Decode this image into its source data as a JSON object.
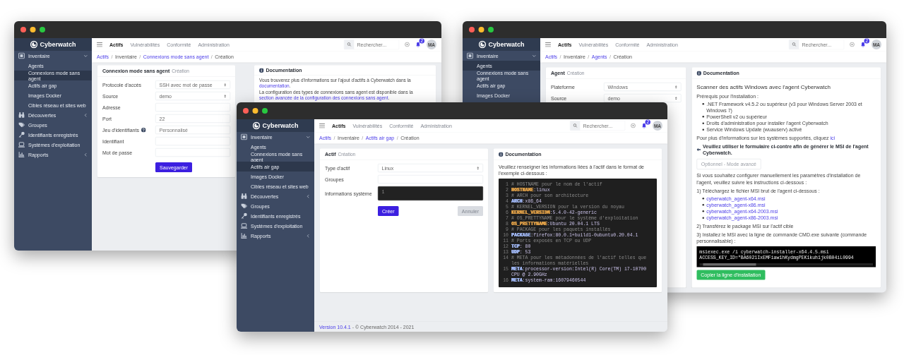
{
  "windows": [
    {
      "sidebar": {
        "logo": "Cyberwatch",
        "items": [
          {
            "kind": "group",
            "label": "Inventaire",
            "expanded": true,
            "children": [
              {
                "label": "Agents",
                "selected": false
              },
              {
                "label": "Connexions mode sans agent",
                "selected": true
              },
              {
                "label": "Actifs air gap",
                "selected": false
              },
              {
                "label": "Images Docker",
                "selected": false
              },
              {
                "label": "Cibles réseau et sites web",
                "selected": false
              }
            ]
          },
          {
            "kind": "group",
            "label": "Découvertes",
            "expanded": false
          },
          {
            "kind": "link",
            "label": "Groupes"
          },
          {
            "kind": "link",
            "label": "Identifiants enregistrés"
          },
          {
            "kind": "link",
            "label": "Systèmes d'exploitation"
          },
          {
            "kind": "group",
            "label": "Rapports",
            "expanded": false
          }
        ]
      },
      "topbar": {
        "tabs": [
          {
            "label": "Actifs",
            "selected": true
          },
          {
            "label": "Vulnérabilités",
            "selected": false
          },
          {
            "label": "Conformité",
            "selected": false
          },
          {
            "label": "Administration",
            "selected": false
          }
        ],
        "search_placeholder": "Rechercher...",
        "badge": "2",
        "avatar": "MA"
      },
      "breadcrumb": {
        "separator": "/",
        "items": [
          {
            "label": "Actifs",
            "link": true
          },
          {
            "label": "Inventaire",
            "link": false
          },
          {
            "label": "Connexions mode sans agent",
            "link": true
          },
          {
            "label": "Création",
            "link": false
          }
        ]
      },
      "form": {
        "title": "Connexion mode sans agent",
        "subtitle": "Création",
        "fields": [
          {
            "label": "Protocole d'accès",
            "kind": "select",
            "value": "SSH avec mot de passe"
          },
          {
            "label": "Source",
            "kind": "select",
            "value": "demo"
          },
          {
            "label": "Adresse",
            "kind": "input"
          },
          {
            "label": "Port",
            "kind": "input",
            "value": "22"
          },
          {
            "label": "Jeu d'identifiants",
            "kind": "input",
            "help": true,
            "placeholder": "Personnalisé"
          },
          {
            "label": "Identifiant",
            "kind": "input"
          },
          {
            "label": "Mot de passe",
            "kind": "input"
          }
        ],
        "buttons": [
          {
            "label": "Sauvegarder",
            "kind": "primary"
          }
        ]
      },
      "documentation": {
        "title": "Documentation",
        "blocks": [
          {
            "kind": "paragraph",
            "text": "Vous trouverez plus d'informations sur l'ajout d'actifs à Cyberwatch dans la ",
            "link": "documentation",
            "after": "."
          },
          {
            "kind": "paragraph",
            "text": "La configuration des types de connexions sans agent est disponible dans la ",
            "link": "section avancée de la configuration des connexions sans agent",
            "after": "."
          }
        ]
      }
    },
    {
      "sidebar": {
        "logo": "Cyberwatch",
        "items": [
          {
            "kind": "group",
            "label": "Inventaire",
            "expanded": true,
            "children": [
              {
                "label": "Agents",
                "selected": true
              },
              {
                "label": "Connexions mode sans agent",
                "selected": false
              },
              {
                "label": "Actifs air gap",
                "selected": false
              },
              {
                "label": "Images Docker",
                "selected": false
              }
            ]
          }
        ]
      },
      "topbar": {
        "tabs": [
          {
            "label": "Actifs",
            "selected": true
          },
          {
            "label": "Vulnérabilités",
            "selected": false
          },
          {
            "label": "Conformité",
            "selected": false
          },
          {
            "label": "Administration",
            "selected": false
          }
        ],
        "search_placeholder": "Rechercher...",
        "badge": "2",
        "avatar": "MA"
      },
      "breadcrumb": {
        "separator": "/",
        "items": [
          {
            "label": "Actifs",
            "link": true
          },
          {
            "label": "Inventaire",
            "link": false
          },
          {
            "label": "Agents",
            "link": true
          },
          {
            "label": "Création",
            "link": false
          }
        ]
      },
      "form": {
        "title": "Agent",
        "subtitle": "Création",
        "fields": [
          {
            "label": "Plateforme",
            "kind": "select",
            "value": "Windows"
          },
          {
            "label": "Source",
            "kind": "select",
            "value": "demo"
          }
        ]
      },
      "documentation": {
        "title": "Documentation",
        "blocks": [
          {
            "kind": "heading",
            "text": "Scanner des actifs Windows avec l'agent Cyberwatch"
          },
          {
            "kind": "paragraph",
            "text": "Prérequis pour l'installation :"
          },
          {
            "kind": "list",
            "items": [
              ".NET Framework v4.5.2 ou supérieur (v3 pour Windows Server 2003 et Windows 7)",
              "PowerShell v2 ou supérieur",
              "Droits d'administration pour installer l'agent Cyberwatch",
              "Service Windows Update (wuauserv) activé"
            ]
          },
          {
            "kind": "paragraph",
            "text": "Pour plus d'informations sur les systèmes supportés, cliquez ",
            "link": "ici"
          },
          {
            "kind": "note",
            "text": "Veuillez utiliser le formulaire ci-contre afin de générer le MSI de l'agent Cyberwatch."
          },
          {
            "kind": "toggle",
            "label": "Optionnel - Mode avancé"
          },
          {
            "kind": "paragraph",
            "text": "Si vous souhaitez configurer manuellement les paramètres d'installation de l'agent, veuillez suivre les instructions ci-dessous :"
          },
          {
            "kind": "paragraph",
            "text": "1) Téléchargez le fichier MSI brut de l'agent ci-dessous :"
          },
          {
            "kind": "links",
            "items": [
              "cyberwatch_agent-x64.msi",
              "cyberwatch_agent-x86.msi",
              "cyberwatch_agent-x64-2003.msi",
              "cyberwatch_agent-x86-2003.msi"
            ]
          },
          {
            "kind": "paragraph",
            "text": "2) Transférez le package MSI sur l'actif cible"
          },
          {
            "kind": "paragraph",
            "text": "3) Installez le MSI avec la ligne de commande CMD.exe suivante (commande personnalisable) :"
          },
          {
            "kind": "command",
            "text": "msiexec.exe /i cyberwatch-installer-x64.4.5.msi ACCESS_KEY_ID=\"BA6021IxEMFiaw1hKydmgPEK1kuh1jk0B04iL0994"
          },
          {
            "kind": "button",
            "label": "Copier la ligne d'installation"
          }
        ]
      }
    },
    {
      "sidebar": {
        "logo": "Cyberwatch",
        "items": [
          {
            "kind": "group",
            "label": "Inventaire",
            "expanded": true,
            "children": [
              {
                "label": "Agents",
                "selected": false
              },
              {
                "label": "Connexions mode sans agent",
                "selected": false
              },
              {
                "label": "Actifs air gap",
                "selected": true
              },
              {
                "label": "Images Docker",
                "selected": false
              },
              {
                "label": "Cibles réseau et sites web",
                "selected": false
              }
            ]
          },
          {
            "kind": "group",
            "label": "Découvertes",
            "expanded": false
          },
          {
            "kind": "link",
            "label": "Groupes"
          },
          {
            "kind": "link",
            "label": "Identifiants enregistrés"
          },
          {
            "kind": "link",
            "label": "Systèmes d'exploitation"
          },
          {
            "kind": "group",
            "label": "Rapports",
            "expanded": false
          }
        ]
      },
      "topbar": {
        "tabs": [
          {
            "label": "Actifs",
            "selected": true
          },
          {
            "label": "Vulnérabilités",
            "selected": false
          },
          {
            "label": "Conformité",
            "selected": false
          },
          {
            "label": "Administration",
            "selected": false
          }
        ],
        "search_placeholder": "Rechercher...",
        "badge": "2",
        "avatar": "MA"
      },
      "breadcrumb": {
        "separator": "/",
        "items": [
          {
            "label": "Actifs",
            "link": true
          },
          {
            "label": "Inventaire",
            "link": false
          },
          {
            "label": "Actifs air gap",
            "link": true
          },
          {
            "label": "Création",
            "link": false
          }
        ]
      },
      "form": {
        "title": "Actif",
        "subtitle": "Création",
        "fields": [
          {
            "label": "Type d'actif",
            "kind": "select",
            "value": "Linux"
          },
          {
            "label": "Groupes",
            "kind": "input"
          },
          {
            "label": "Informations système",
            "kind": "code",
            "line": "1"
          }
        ],
        "buttons": [
          {
            "label": "Créer",
            "kind": "primary"
          },
          {
            "label": "Annuler",
            "kind": "secondary"
          }
        ]
      },
      "documentation": {
        "title": "Documentation",
        "blocks": [
          {
            "kind": "paragraph",
            "text": "Veuillez renseigner les informations liées à l'actif dans le format de l'exemple ci-dessous :"
          },
          {
            "kind": "code",
            "lines": [
              {
                "no": "1",
                "kind": "comment",
                "text": "# HOSTNAME pour le nom de l'actif"
              },
              {
                "no": "2",
                "kind": "entry",
                "key": "HOSTNAME",
                "value": ":linux",
                "color": "#e0a048"
              },
              {
                "no": "3",
                "kind": "comment",
                "text": "# ARCH pour son architecture"
              },
              {
                "no": "4",
                "kind": "entry",
                "key": "ARCH",
                "value": ":x86_64",
                "color": "#9fb6f2"
              },
              {
                "no": "5",
                "kind": "comment",
                "text": "# KERNEL_VERSION pour la version du noyau"
              },
              {
                "no": "6",
                "kind": "entry",
                "key": "KERNEL_VERSION",
                "value": ":5.4.0-42-generic",
                "color": "#e0a048"
              },
              {
                "no": "7",
                "kind": "comment",
                "text": "# OS_PRETTYNAME pour le système d'exploitation"
              },
              {
                "no": "8",
                "kind": "entry",
                "key": "OS_PRETTYNAME",
                "value": ":Ubuntu 20.04.1 LTS",
                "color": "#e0a048"
              },
              {
                "no": "9",
                "kind": "comment",
                "text": "# PACKAGE pour les paquets installés"
              },
              {
                "no": "10",
                "kind": "entry",
                "key": "PACKAGE",
                "value": ":firefox:80.0.1+build1-0ubuntu0.20.04.1",
                "color": "#9fb6f2"
              },
              {
                "no": "11",
                "kind": "comment",
                "text": "# Ports exposés en TCP ou UDP"
              },
              {
                "no": "12",
                "kind": "entry",
                "key": "TCP",
                "value": ": 80",
                "color": "#9fb6f2"
              },
              {
                "no": "13",
                "kind": "entry",
                "key": "UDP",
                "value": ": 53",
                "color": "#9fb6f2"
              },
              {
                "no": "14",
                "kind": "comment",
                "text": "# META pour les métadonnées de l'actif telles que les informations matérielles"
              },
              {
                "no": "15",
                "kind": "entry",
                "key": "META",
                "value": ":processor-version:Intel(R) Core(TM) i7-10700 CPU @ 2.90GHz",
                "color": "#9fb6f2"
              },
              {
                "no": "16",
                "kind": "entry",
                "key": "META",
                "value": ":system-ram:16079460544",
                "color": "#9fb6f2"
              }
            ]
          }
        ]
      },
      "footer": {
        "version": "Version 10.4.1",
        "text": " - © Cyberwatch 2014 - 2021"
      }
    }
  ]
}
